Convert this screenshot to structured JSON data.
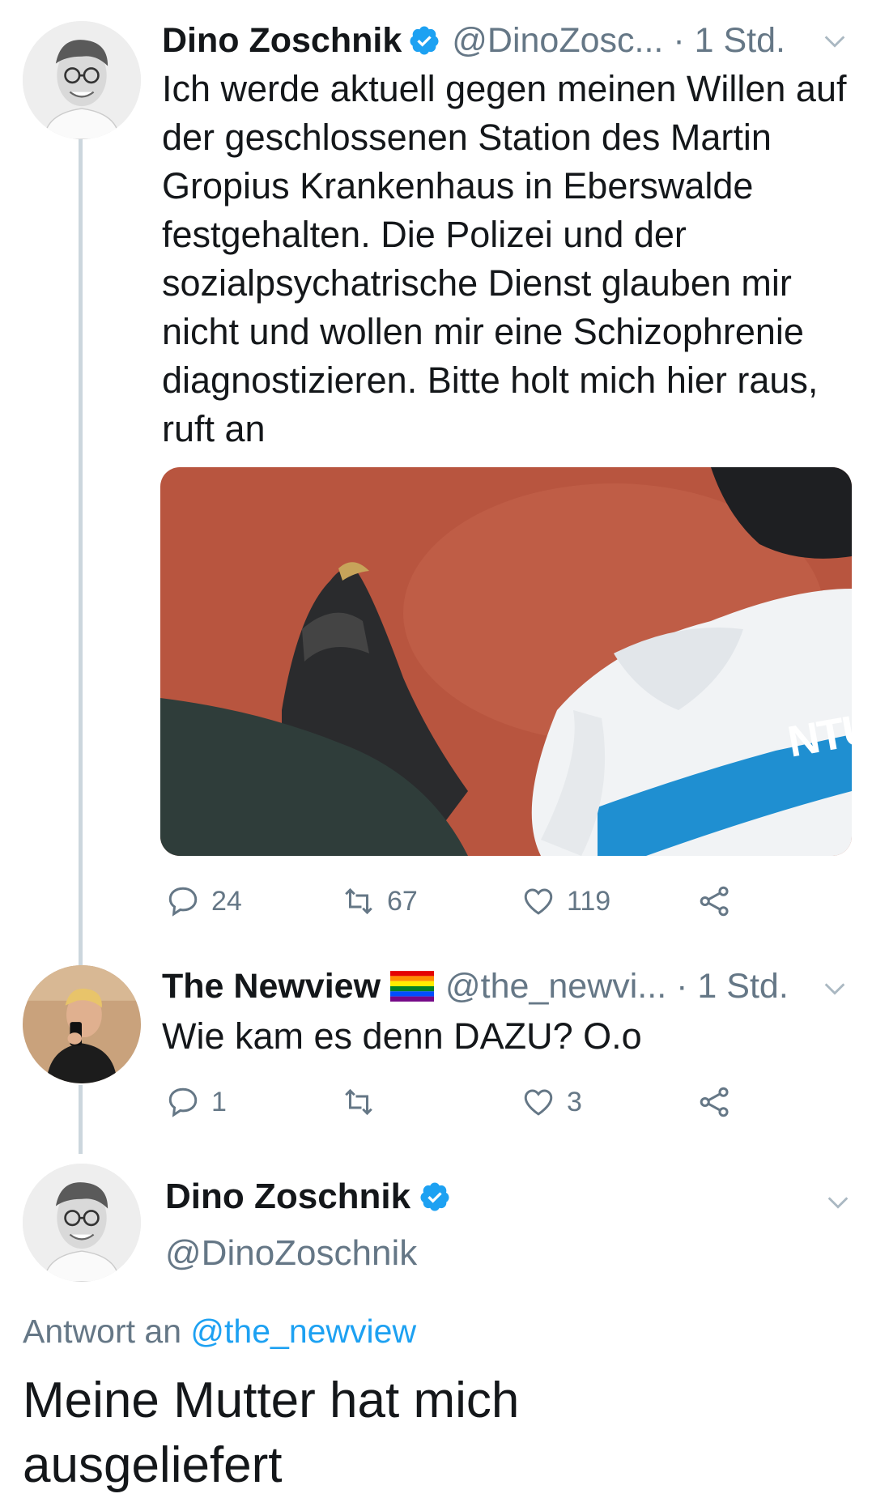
{
  "thread": {
    "tweet1": {
      "display_name": "Dino Zoschnik",
      "handle": "@DinoZosc...",
      "time": "· 1 Std.",
      "text": "Ich werde aktuell gegen meinen Willen auf der geschlossenen Station des Martin Gropius Krankenhaus in Eberswalde festgehalten. Die Polizei und der sozialpsychatrische Dienst glauben mir nicht und wollen mir eine Schizophrenie diagnostizieren. Bitte holt mich hier raus, ruft an",
      "image_text": "NTU",
      "replies": "24",
      "retweets": "67",
      "likes": "119"
    },
    "tweet2": {
      "display_name": "The Newview",
      "handle": "@the_newvi...",
      "time": "· 1 Std.",
      "text": "Wie kam es denn DAZU? O.o",
      "replies": "1",
      "retweets": "",
      "likes": "3"
    },
    "tweet3": {
      "display_name": "Dino Zoschnik",
      "handle": "@DinoZoschnik",
      "reply_prefix": "Antwort an",
      "reply_to": "@the_newview",
      "text": "Meine Mutter hat mich ausgeliefert"
    }
  },
  "colors": {
    "link": "#1da1f2",
    "verified": "#1da1f2",
    "secondary_text": "#657786",
    "thread_line": "#ccd6dd"
  },
  "icons": [
    "verified-badge-icon",
    "chevron-down-icon",
    "reply-icon",
    "retweet-icon",
    "like-icon",
    "share-icon",
    "rainbow-flag-icon"
  ]
}
